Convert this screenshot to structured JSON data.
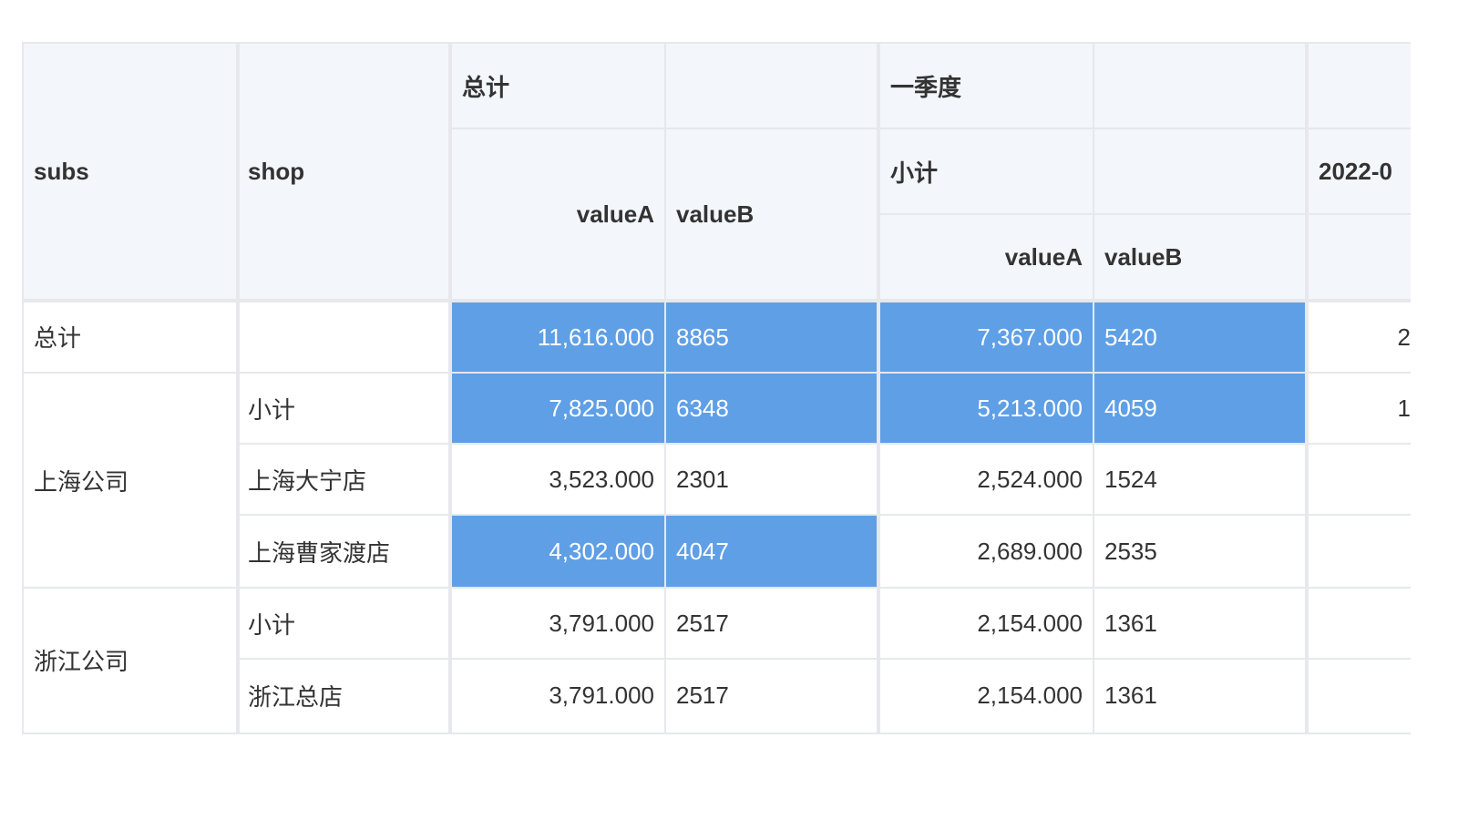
{
  "header": {
    "row_dim_1": "subs",
    "row_dim_2": "shop",
    "total_group": "总计",
    "q1_group": "一季度",
    "q1_subtotal": "小计",
    "month_group": "2022-0",
    "measure_a": "valueA",
    "measure_b": "valueB"
  },
  "rows": {
    "grand_total_label": "总计",
    "shanghai_company": "上海公司",
    "zhejiang_company": "浙江公司",
    "subtotal_label": "小计",
    "shop_dangning": "上海大宁店",
    "shop_caojiadu": "上海曹家渡店",
    "shop_zhejiang_hq": "浙江总店"
  },
  "table": [
    {
      "total_a": "11,616.000",
      "total_b": "8865",
      "q1_a": "7,367.000",
      "q1_b": "5420",
      "partial": "2"
    },
    {
      "total_a": "7,825.000",
      "total_b": "6348",
      "q1_a": "5,213.000",
      "q1_b": "4059",
      "partial": "1"
    },
    {
      "total_a": "3,523.000",
      "total_b": "2301",
      "q1_a": "2,524.000",
      "q1_b": "1524",
      "partial": ""
    },
    {
      "total_a": "4,302.000",
      "total_b": "4047",
      "q1_a": "2,689.000",
      "q1_b": "2535",
      "partial": ""
    },
    {
      "total_a": "3,791.000",
      "total_b": "2517",
      "q1_a": "2,154.000",
      "q1_b": "1361",
      "partial": ""
    },
    {
      "total_a": "3,791.000",
      "total_b": "2517",
      "q1_a": "2,154.000",
      "q1_b": "1361",
      "partial": ""
    }
  ],
  "colors": {
    "header_bg": "#f3f6fa",
    "highlight_bg": "#5f9fe6",
    "grid_line": "#e6e8ec",
    "text": "#333333"
  }
}
